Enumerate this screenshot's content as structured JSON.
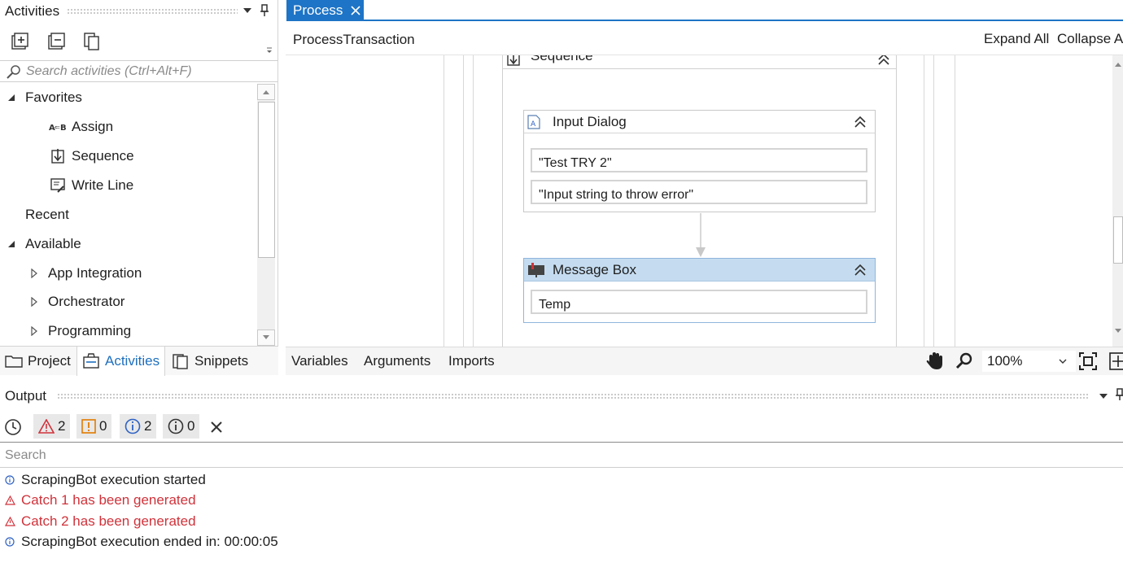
{
  "activities_panel": {
    "title": "Activities",
    "search_placeholder": "Search activities (Ctrl+Alt+F)",
    "tree": [
      {
        "label": "Favorites",
        "expanded": true
      },
      {
        "label": "Assign",
        "icon": "assign-icon"
      },
      {
        "label": "Sequence",
        "icon": "sequence-icon"
      },
      {
        "label": "Write Line",
        "icon": "write-line-icon"
      },
      {
        "label": "Recent"
      },
      {
        "label": "Available",
        "expanded": true
      },
      {
        "label": "App Integration",
        "expanded": false
      },
      {
        "label": "Orchestrator",
        "expanded": false
      },
      {
        "label": "Programming",
        "expanded": false
      }
    ],
    "tabs": [
      {
        "label": "Project",
        "active": false
      },
      {
        "label": "Activities",
        "active": true
      },
      {
        "label": "Snippets",
        "active": false
      }
    ]
  },
  "editor": {
    "tab_label": "Process",
    "breadcrumb": "ProcessTransaction",
    "expand_all": "Expand All",
    "collapse_all": "Collapse All",
    "sequence_title": "Sequence",
    "input_dialog": {
      "title": "Input Dialog",
      "fields": [
        "\"Test TRY 2\"",
        "\"Input string to throw error\""
      ]
    },
    "message_box": {
      "title": "Message Box",
      "fields": [
        "Temp"
      ]
    },
    "footer_tabs": [
      "Variables",
      "Arguments",
      "Imports"
    ],
    "zoom": "100%"
  },
  "output": {
    "title": "Output",
    "counts": {
      "errors": "2",
      "warnings": "0",
      "info": "2",
      "trace": "0"
    },
    "search_placeholder": "Search",
    "logs": [
      {
        "level": "info",
        "text": "ScrapingBot execution started"
      },
      {
        "level": "error",
        "text": "Catch 1 has been generated"
      },
      {
        "level": "error",
        "text": "Catch 2 has been generated"
      },
      {
        "level": "info",
        "text": "ScrapingBot execution ended in: 00:00:05"
      }
    ]
  },
  "colors": {
    "accent": "#1e74c6",
    "error": "#d0323a",
    "warning": "#e07b00",
    "info": "#2f62c4",
    "selected_header": "#c5dcf0"
  }
}
